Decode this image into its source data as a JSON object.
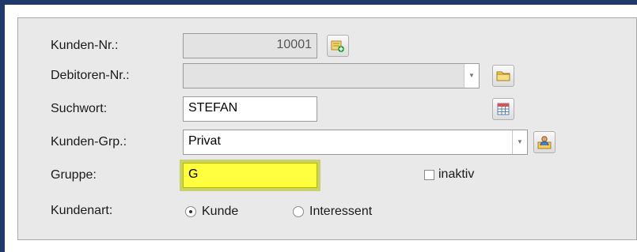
{
  "form": {
    "kunden_nr": {
      "label": "Kunden-Nr.:",
      "value": "10001"
    },
    "debitoren_nr": {
      "label": "Debitoren-Nr.:",
      "value": ""
    },
    "suchwort": {
      "label": "Suchwort:",
      "value": "STEFAN"
    },
    "kunden_grp": {
      "label": "Kunden-Grp.:",
      "value": "Privat"
    },
    "gruppe": {
      "label": "Gruppe:",
      "value": "G"
    },
    "inaktiv": {
      "label": "inaktiv",
      "checked": false
    },
    "kundenart": {
      "label": "Kundenart:",
      "options": [
        {
          "label": "Kunde",
          "selected": true
        },
        {
          "label": "Interessent",
          "selected": false
        }
      ]
    }
  },
  "colors": {
    "highlight": "#ffff40",
    "frame": "#1f3a6a",
    "panel": "#e9e9e9"
  },
  "icons": {
    "kunden_nr_button": "new-record-icon",
    "debitoren_nr_button": "folder-icon",
    "suchwort_button": "grid-icon",
    "kunden_grp_button": "user-group-icon"
  }
}
